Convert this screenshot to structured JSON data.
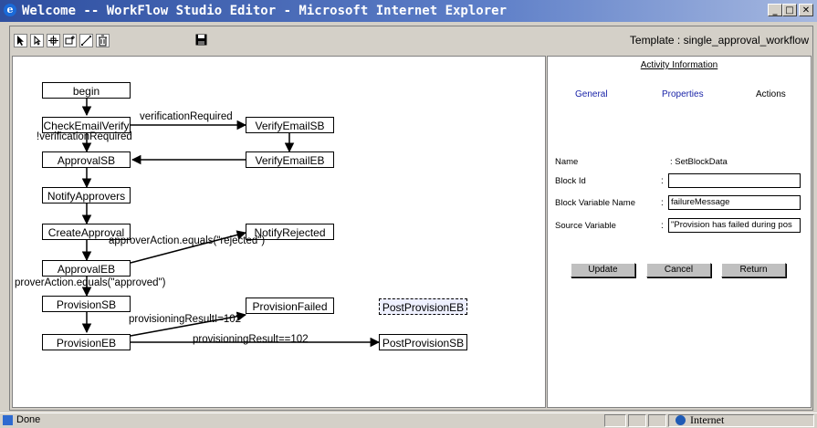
{
  "window": {
    "title": "Welcome -- WorkFlow Studio Editor - Microsoft Internet Explorer",
    "controls": [
      "_",
      "□",
      "✕"
    ]
  },
  "toolbar": {
    "tools": [
      "select-tool",
      "pointer-tool",
      "move-tool",
      "add-node-tool",
      "link-tool",
      "delete-tool"
    ],
    "save": "save-icon",
    "template_label": "Template : single_approval_workflow"
  },
  "diagram": {
    "nodes": {
      "begin": "begin",
      "check_email_verify": "CheckEmailVerify",
      "verify_email_sb": "VerifyEmailSB",
      "approval_sb": "ApprovalSB",
      "verify_email_eb": "VerifyEmailEB",
      "notify_approvers": "NotifyApprovers",
      "create_approval": "CreateApproval",
      "notify_rejected": "NotifyRejected",
      "approval_eb": "ApprovalEB",
      "provision_sb": "ProvisionSB",
      "provision_failed": "ProvisionFailed",
      "post_provision_eb": "PostProvisionEB",
      "provision_eb": "ProvisionEB",
      "post_provision_sb": "PostProvisionSB"
    },
    "edges": {
      "verification_required": "verificationRequired",
      "not_verification_required": "!verificationRequired",
      "rejected": "approverAction.equals(\"rejected\")",
      "approved": "proverAction.equals(\"approved\")",
      "prov_failed": "provisioningResult!=102",
      "prov_ok": "provisioningResult==102"
    }
  },
  "panel": {
    "title": "Activity Information",
    "tabs": {
      "general": "General",
      "properties": "Properties",
      "actions": "Actions"
    },
    "fields": {
      "name_label": "Name",
      "name_value": ": SetBlockData",
      "block_id_label": "Block Id",
      "block_id_value": "",
      "block_var_label": "Block Variable Name",
      "block_var_value": "failureMessage",
      "source_var_label": "Source Variable",
      "source_var_value": "\"Provision has failed during pos"
    },
    "buttons": {
      "update": "Update",
      "cancel": "Cancel",
      "return": "Return"
    }
  },
  "statusbar": {
    "status": "Done",
    "zone": "Internet"
  },
  "colors": {
    "title_gradient_start": "#2e4fa0",
    "active_tab": "#1a24a8",
    "chrome": "#d4d0c8"
  }
}
